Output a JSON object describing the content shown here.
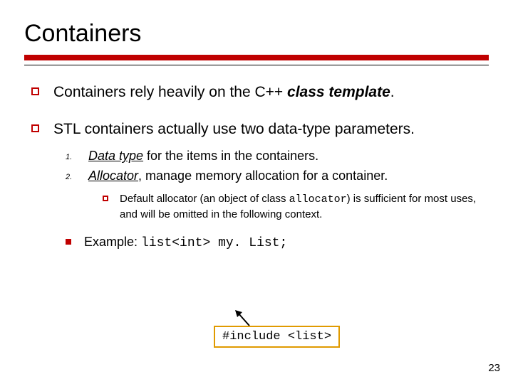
{
  "title": "Containers",
  "bullets": [
    {
      "plain1": "Containers rely heavily on the C++ ",
      "boldital": "class template",
      "plain2": "."
    },
    {
      "plain1": "STL containers actually use two data-type parameters."
    }
  ],
  "numbered": [
    {
      "num": "1.",
      "lead_ul": "Data type",
      "rest": " for the items in the containers."
    },
    {
      "num": "2.",
      "lead_ul": "Allocator",
      "rest": ", manage memory allocation for a container."
    }
  ],
  "subnote": {
    "p1": "Default allocator (an object of class ",
    "code": "allocator",
    "p2": ") is sufficient for most uses, and will be omitted in the following context."
  },
  "example": {
    "label": "Example: ",
    "code": "list<int> my. List;"
  },
  "callout": "#include <list>",
  "page_number": "23"
}
